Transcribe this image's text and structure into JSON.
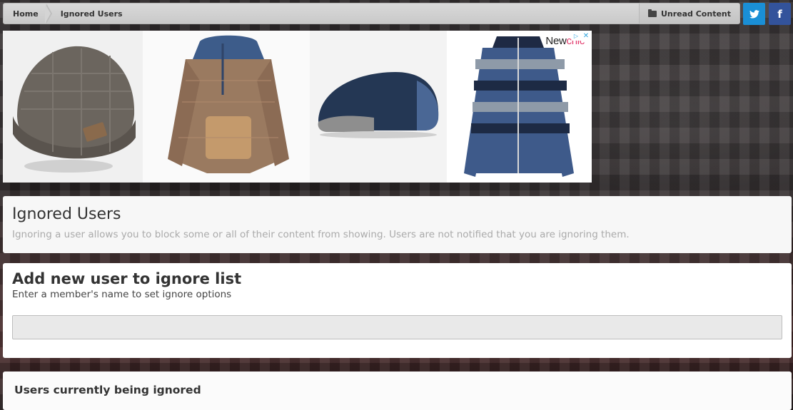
{
  "breadcrumb": {
    "home": "Home",
    "current": "Ignored Users"
  },
  "unread_content": "Unread Content",
  "social": {
    "twitter_icon": "twitter-icon",
    "facebook_icon": "facebook-icon",
    "twitter_color": "#1a8fd6",
    "facebook_color": "#33539b"
  },
  "ad": {
    "brand_part1": "New",
    "brand_part2": "chic",
    "products": [
      "knit beanie hat",
      "knit hooded sweater",
      "flat cap",
      "striped zip cardigan"
    ]
  },
  "intro": {
    "title": "Ignored Users",
    "description": "Ignoring a user allows you to block some or all of their content from showing. Users are not notified that you are ignoring them."
  },
  "add_user": {
    "title": "Add new user to ignore list",
    "description": "Enter a member's name to set ignore options",
    "input_value": ""
  },
  "ignored_list": {
    "title": "Users currently being ignored"
  }
}
